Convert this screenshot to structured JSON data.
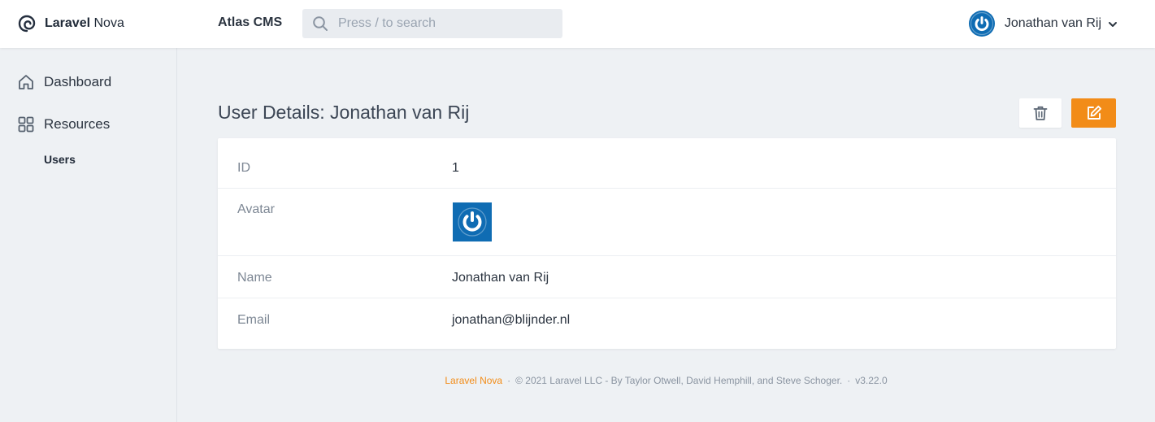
{
  "brand": {
    "bold": "Laravel",
    "rest": " Nova",
    "icon": "laravel-nova-logo"
  },
  "header": {
    "app_name": "Atlas CMS",
    "search": {
      "placeholder": "Press / to search",
      "value": "",
      "icon": "search-icon"
    },
    "user": {
      "name": "Jonathan van Rij",
      "icon": "power-icon",
      "menu_icon": "chevron-down-icon"
    }
  },
  "sidebar": {
    "items": [
      {
        "label": "Dashboard",
        "icon": "home-icon"
      },
      {
        "label": "Resources",
        "icon": "grid-icon"
      }
    ],
    "sub_items": [
      {
        "label": "Users"
      }
    ]
  },
  "main": {
    "title": "User Details: Jonathan van Rij",
    "actions": {
      "delete_icon": "trash-icon",
      "edit_icon": "edit-icon"
    },
    "fields": [
      {
        "label": "ID",
        "value": "1"
      },
      {
        "label": "Avatar"
      },
      {
        "label": "Name",
        "value": "Jonathan van Rij"
      },
      {
        "label": "Email",
        "value": "jonathan@blijnder.nl"
      }
    ]
  },
  "footer": {
    "brand": "Laravel Nova",
    "separator": "·",
    "copyright": "© 2021 Laravel LLC - By Taylor Otwell, David Hemphill, and Steve Schoger.",
    "version": "v3.22.0"
  },
  "colors": {
    "accent": "#f28c18",
    "avatar_blue": "#0f6cb3",
    "background": "#eef1f4",
    "card": "#ffffff"
  }
}
